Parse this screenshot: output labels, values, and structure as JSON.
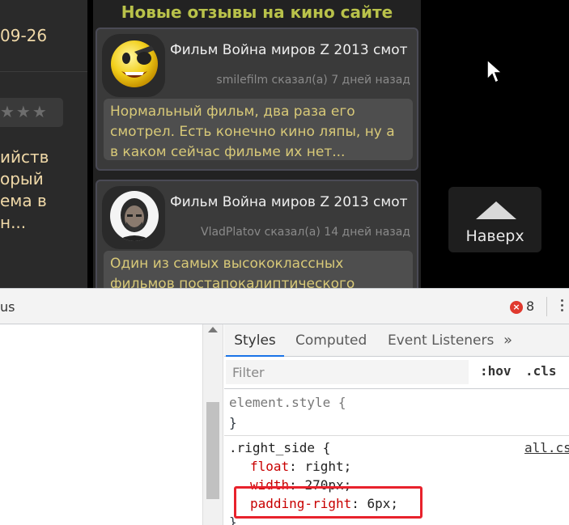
{
  "site": {
    "left_column": {
      "date": "09-26",
      "stars": "★★★",
      "excerpt_lines": [
        "ийств",
        "орый",
        "ема в",
        " н..."
      ]
    },
    "reviews_title": "Новые отзывы на кино сайте",
    "reviews": [
      {
        "film": "Фильм Война миров Z 2013 смот",
        "meta": "smilefilm сказал(а) 7 дней назад",
        "text": "Нормальный фильм, два раза его смотрел. Есть конечно кино ляпы, ну а в каком сейчас фильме их нет..."
      },
      {
        "film": "Фильм Война миров Z 2013 смот",
        "meta": "VladPlatov сказал(а) 14 дней назад",
        "text": "Один из самых высококлассных фильмов постапокалиптического"
      }
    ],
    "to_top_label": "Наверх"
  },
  "devtools": {
    "toolbar_text": "us",
    "error_count": "8",
    "tabs": [
      "Styles",
      "Computed",
      "Event Listeners",
      "»"
    ],
    "filter_placeholder": "Filter",
    "hov_label": ":hov",
    "cls_label": ".cls",
    "element_style": {
      "selector": "element.style {",
      "close": "}"
    },
    "rule": {
      "selector": ".right_side {",
      "source": "all.cs",
      "declarations": [
        {
          "prop": "float",
          "value": "right;"
        },
        {
          "prop": "width",
          "value": "270px;"
        },
        {
          "prop": "padding-right",
          "value": "6px;"
        }
      ],
      "close": "}"
    }
  },
  "colors": {
    "review_title": "#b9c24a",
    "review_body_text": "#d8c978",
    "property_name": "#c80000",
    "highlight_border": "#e8222c",
    "active_tab_underline": "#1a73e8"
  }
}
